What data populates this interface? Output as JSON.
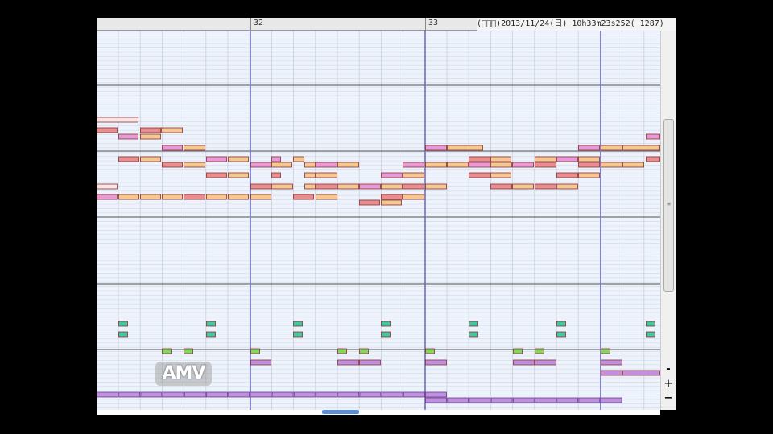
{
  "app": {
    "status_text": "(ﾞｰﾞ)2013/11/24(日) 10h33m23s252( 1287)"
  },
  "ruler": {
    "measures": [
      "32",
      "33"
    ]
  },
  "controls": {
    "zoom_in_label": "+",
    "zoom_out_label": "−",
    "minimize_label": "-"
  },
  "logo": {
    "text": "AMV"
  },
  "colors": {
    "note_pink": "#e89ad8",
    "note_orange": "#f4c890",
    "note_red": "#e88e8e",
    "note_white": "#f8e6e6",
    "note_teal": "#40c8a0",
    "note_green": "#80d860",
    "note_lavender": "#c090e0",
    "note_border": "#8a3030",
    "measure_line": "#7070c0"
  },
  "icons": {
    "logo": "amv-logo",
    "scroll_grip": "grip-icon"
  }
}
